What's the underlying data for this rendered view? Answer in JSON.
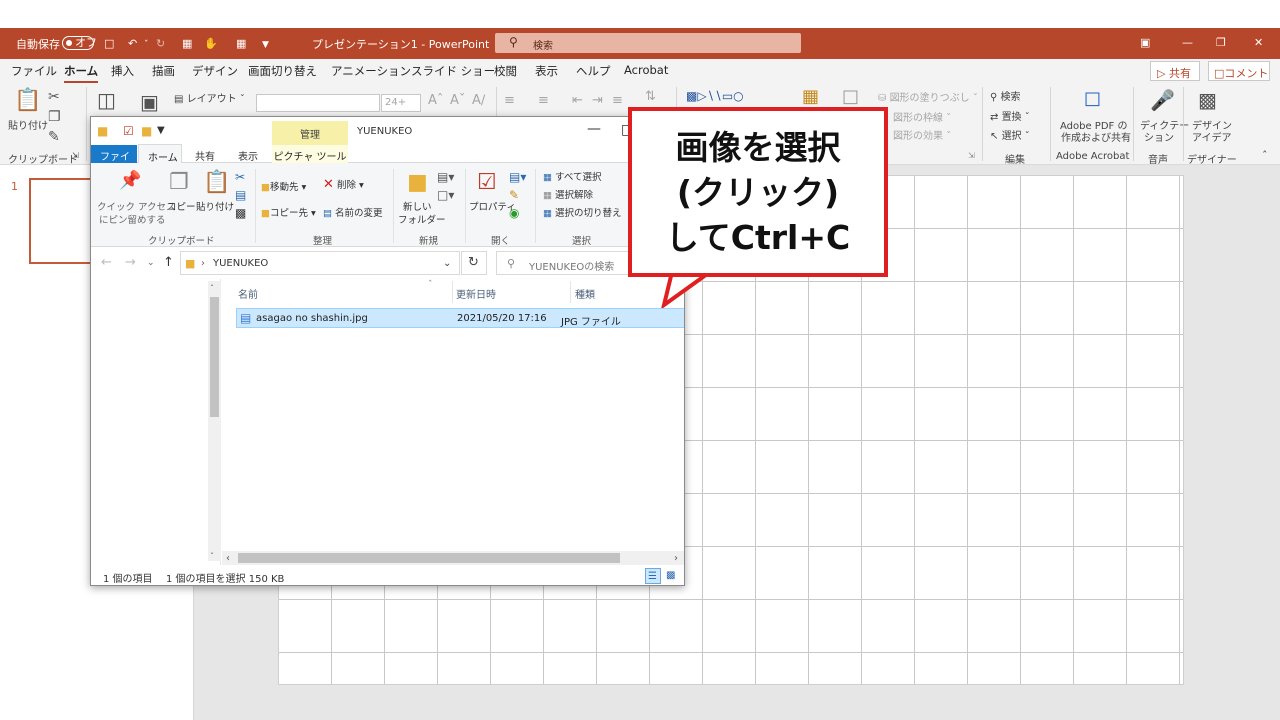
{
  "titlebar": {
    "autosave": "自動保存",
    "autosave_state": "オフ",
    "title": "プレゼンテーション1  -  PowerPoint",
    "search_placeholder": "検索"
  },
  "ribbon_tabs": [
    "ファイル",
    "ホーム",
    "挿入",
    "描画",
    "デザイン",
    "画面切り替え",
    "アニメーション",
    "スライド ショー",
    "校閲",
    "表示",
    "ヘルプ",
    "Acrobat"
  ],
  "share": "共有",
  "comment": "コメント",
  "ribbon": {
    "paste": "貼り付け",
    "clipboard": "クリップボード",
    "layout": "レイアウト",
    "font_size": "24+",
    "shape_fill": "図形の塗りつぶし",
    "shape_outline": "図形の枠線",
    "shape_effect": "図形の効果",
    "find": "検索",
    "replace": "置換",
    "select": "選択",
    "editing": "編集",
    "adobe_pdf_1": "Adobe PDF の",
    "adobe_pdf_2": "作成および共有",
    "adobe_acrobat": "Adobe Acrobat",
    "dictation_1": "ディクテー",
    "dictation_2": "ション",
    "voice": "音声",
    "designer_1": "デザイン",
    "designer_2": "アイデア",
    "designer": "デザイナー"
  },
  "slide_number": "1",
  "explorer": {
    "manage": "管理",
    "folder_title": "YUENUKEO",
    "tabs": {
      "file": "ファイル",
      "home": "ホーム",
      "share": "共有",
      "view": "表示",
      "picture_tools": "ピクチャ ツール"
    },
    "ribbon": {
      "pin_1": "クイック アクセス",
      "pin_2": "にピン留めする",
      "copy": "コピー",
      "paste": "貼り付け",
      "clipboard_group": "クリップボード",
      "move_to": "移動先",
      "copy_to": "コピー先",
      "delete": "削除",
      "rename": "名前の変更",
      "organize_group": "整理",
      "new_folder_1": "新しい",
      "new_folder_2": "フォルダー",
      "new_group": "新規",
      "properties": "プロパティ",
      "open_group": "開く",
      "select_all": "すべて選択",
      "select_none": "選択解除",
      "invert_selection": "選択の切り替え",
      "select_group": "選択"
    },
    "address": "YUENUKEO",
    "search_placeholder": "YUENUKEOの検索",
    "columns": {
      "name": "名前",
      "date": "更新日時",
      "type": "種類"
    },
    "files": [
      {
        "name": "asagao no shashin.jpg",
        "date": "2021/05/20 17:16",
        "type": "JPG ファイル"
      }
    ],
    "status": {
      "count": "1 個の項目",
      "selected": "1 個の項目を選択  150 KB"
    }
  },
  "callout": {
    "text": "画像を選択\n(クリック)\nしてCtrl+C",
    "border_color": "#e02020"
  },
  "colors": {
    "powerpoint_accent": "#b7472a",
    "explorer_file_tab": "#1979ca",
    "selection": "#cce8ff"
  }
}
